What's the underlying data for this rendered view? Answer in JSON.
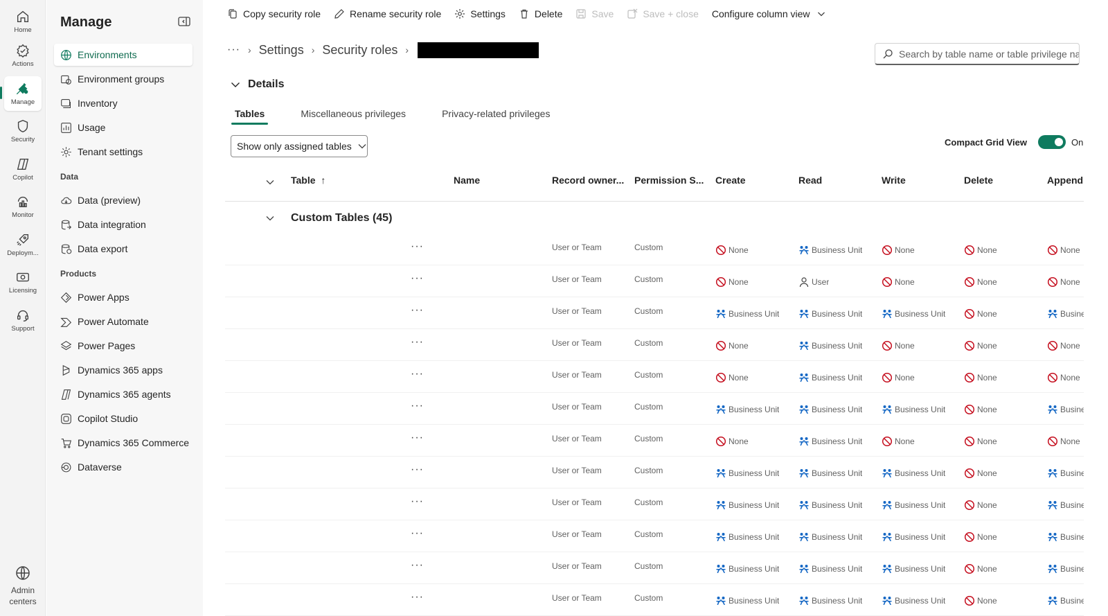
{
  "rail": {
    "items": [
      {
        "label": "Home",
        "icon": "home-icon"
      },
      {
        "label": "Actions",
        "icon": "actions-icon"
      },
      {
        "label": "Manage",
        "icon": "manage-icon"
      },
      {
        "label": "Security",
        "icon": "shield-icon"
      },
      {
        "label": "Copilot",
        "icon": "copilot-icon"
      },
      {
        "label": "Monitor",
        "icon": "monitor-icon"
      },
      {
        "label": "Deploym...",
        "icon": "deployment-icon"
      },
      {
        "label": "Licensing",
        "icon": "licensing-icon"
      },
      {
        "label": "Support",
        "icon": "support-icon"
      }
    ],
    "admin_line1": "Admin",
    "admin_line2": "centers"
  },
  "nav": {
    "title": "Manage",
    "items": [
      {
        "label": "Environments",
        "icon": "globe-icon"
      },
      {
        "label": "Environment groups",
        "icon": "environment-groups-icon"
      },
      {
        "label": "Inventory",
        "icon": "inventory-icon"
      },
      {
        "label": "Usage",
        "icon": "usage-icon"
      },
      {
        "label": "Tenant settings",
        "icon": "gear-icon"
      }
    ],
    "data_section": "Data",
    "data_items": [
      {
        "label": "Data (preview)",
        "icon": "cloud-icon"
      },
      {
        "label": "Data integration",
        "icon": "data-integration-icon"
      },
      {
        "label": "Data export",
        "icon": "data-export-icon"
      }
    ],
    "products_section": "Products",
    "product_items": [
      {
        "label": "Power Apps",
        "icon": "power-apps-icon"
      },
      {
        "label": "Power Automate",
        "icon": "power-automate-icon"
      },
      {
        "label": "Power Pages",
        "icon": "power-pages-icon"
      },
      {
        "label": "Dynamics 365 apps",
        "icon": "dynamics-apps-icon"
      },
      {
        "label": "Dynamics 365 agents",
        "icon": "dynamics-agents-icon"
      },
      {
        "label": "Copilot Studio",
        "icon": "copilot-studio-icon"
      },
      {
        "label": "Dynamics 365 Commerce",
        "icon": "commerce-icon"
      },
      {
        "label": "Dataverse",
        "icon": "dataverse-icon"
      }
    ]
  },
  "toolbar": {
    "copy": "Copy security role",
    "rename": "Rename security role",
    "settings": "Settings",
    "delete": "Delete",
    "save": "Save",
    "save_close": "Save + close",
    "configure": "Configure column view"
  },
  "breadcrumb": {
    "more": "···",
    "settings": "Settings",
    "security_roles": "Security roles"
  },
  "search": {
    "placeholder": "Search by table name or table privilege name"
  },
  "details": {
    "label": "Details"
  },
  "tabs": [
    "Tables",
    "Miscellaneous privileges",
    "Privacy-related privileges"
  ],
  "filter": {
    "value": "Show only assigned tables"
  },
  "compact": {
    "label": "Compact Grid View",
    "state": "On"
  },
  "grid": {
    "columns": [
      "Table",
      "Name",
      "Record owner...",
      "Permission S...",
      "Create",
      "Read",
      "Write",
      "Delete",
      "Append"
    ],
    "sort_indicator": "↑",
    "group_title": "Custom Tables (45)",
    "rows": [
      {
        "owner": "User or Team",
        "perm_set": "Custom",
        "create": "None",
        "read": "Business Unit",
        "write": "None",
        "delete": "None",
        "append": "None"
      },
      {
        "owner": "User or Team",
        "perm_set": "Custom",
        "create": "None",
        "read": "User",
        "write": "None",
        "delete": "None",
        "append": "None"
      },
      {
        "owner": "User or Team",
        "perm_set": "Custom",
        "create": "Business Unit",
        "read": "Business Unit",
        "write": "Business Unit",
        "delete": "None",
        "append": "Busines"
      },
      {
        "owner": "User or Team",
        "perm_set": "Custom",
        "create": "None",
        "read": "Business Unit",
        "write": "None",
        "delete": "None",
        "append": "None"
      },
      {
        "owner": "User or Team",
        "perm_set": "Custom",
        "create": "None",
        "read": "Business Unit",
        "write": "None",
        "delete": "None",
        "append": "None"
      },
      {
        "owner": "User or Team",
        "perm_set": "Custom",
        "create": "Business Unit",
        "read": "Business Unit",
        "write": "Business Unit",
        "delete": "None",
        "append": "Busines"
      },
      {
        "owner": "User or Team",
        "perm_set": "Custom",
        "create": "None",
        "read": "Business Unit",
        "write": "None",
        "delete": "None",
        "append": "None"
      },
      {
        "owner": "User or Team",
        "perm_set": "Custom",
        "create": "Business Unit",
        "read": "Business Unit",
        "write": "Business Unit",
        "delete": "None",
        "append": "Busines"
      },
      {
        "owner": "User or Team",
        "perm_set": "Custom",
        "create": "Business Unit",
        "read": "Business Unit",
        "write": "Business Unit",
        "delete": "None",
        "append": "Busines"
      },
      {
        "owner": "User or Team",
        "perm_set": "Custom",
        "create": "Business Unit",
        "read": "Business Unit",
        "write": "Business Unit",
        "delete": "None",
        "append": "Busines"
      },
      {
        "owner": "User or Team",
        "perm_set": "Custom",
        "create": "Business Unit",
        "read": "Business Unit",
        "write": "Business Unit",
        "delete": "None",
        "append": "Busines"
      },
      {
        "owner": "User or Team",
        "perm_set": "Custom",
        "create": "Business Unit",
        "read": "Business Unit",
        "write": "Business Unit",
        "delete": "None",
        "append": "Busines"
      }
    ]
  },
  "colors": {
    "accent": "#0f7b5f",
    "none_icon": "#c50f1f",
    "bu_icon": "#1467c4"
  }
}
